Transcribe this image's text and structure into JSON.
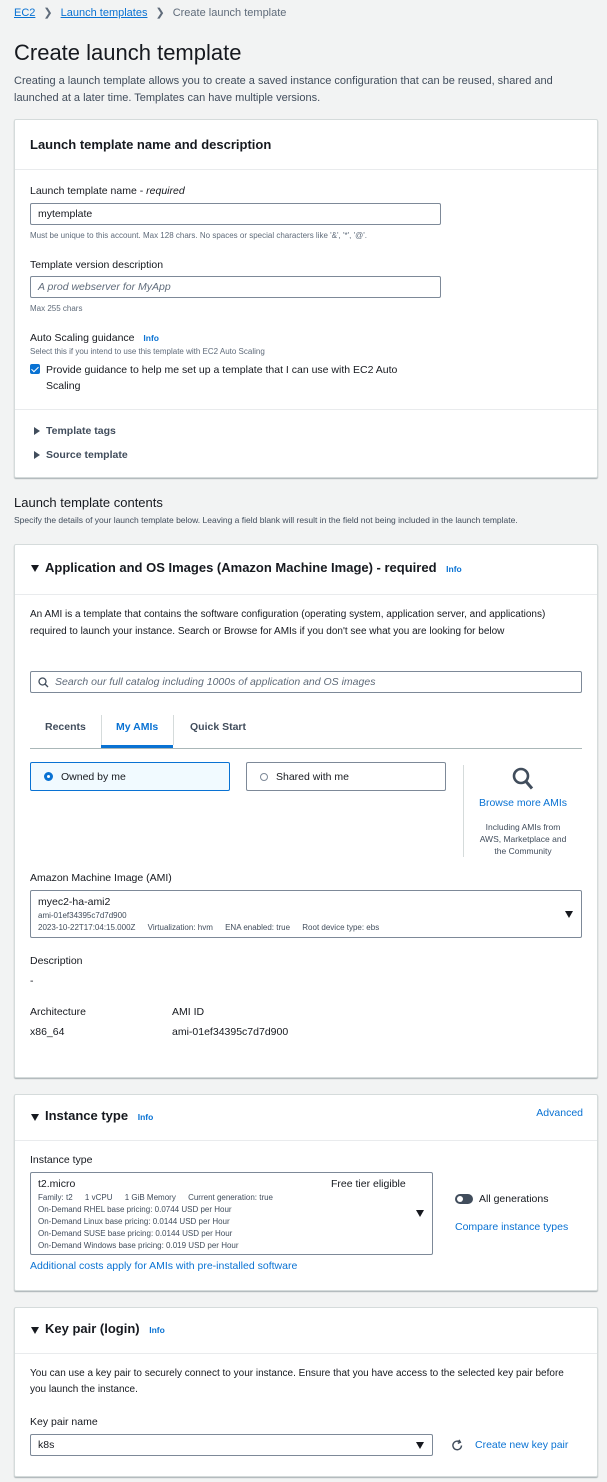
{
  "breadcrumb": {
    "root": "EC2",
    "parent": "Launch templates",
    "current": "Create launch template"
  },
  "page": {
    "title": "Create launch template",
    "subtitle": "Creating a launch template allows you to create a saved instance configuration that can be reused, shared and launched at a later time. Templates can have multiple versions."
  },
  "name_panel": {
    "title": "Launch template name and description",
    "name_label": "Launch template name - ",
    "name_required": "required",
    "name_value": "mytemplate",
    "name_hint": "Must be unique to this account. Max 128 chars. No spaces or special characters like '&', '*', '@'.",
    "desc_label": "Template version description",
    "desc_placeholder": "A prod webserver for MyApp",
    "desc_hint": "Max 255 chars",
    "asg_label": "Auto Scaling guidance",
    "asg_info": "Info",
    "asg_hint": "Select this if you intend to use this template with EC2 Auto Scaling",
    "asg_checkbox": "Provide guidance to help me set up a template that I can use with EC2 Auto Scaling",
    "asg_checked": true,
    "tags_label": "Template tags",
    "source_label": "Source template"
  },
  "contents": {
    "title": "Launch template contents",
    "subtitle": "Specify the details of your launch template below. Leaving a field blank will result in the field not being included in the launch template."
  },
  "ami_panel": {
    "title": "Application and OS Images (Amazon Machine Image) - required",
    "info": "Info",
    "description": "An AMI is a template that contains the software configuration (operating system, application server, and applications) required to launch your instance. Search or Browse for AMIs if you don't see what you are looking for below",
    "search_placeholder": "Search our full catalog including 1000s of application and OS images",
    "tabs": [
      "Recents",
      "My AMIs",
      "Quick Start"
    ],
    "active_tab": "My AMIs",
    "owned_label": "Owned by me",
    "shared_label": "Shared with me",
    "browse_label": "Browse more AMIs",
    "browse_hint": "Including AMIs from AWS, Marketplace and the Community",
    "ami_label": "Amazon Machine Image (AMI)",
    "ami_name": "myec2-ha-ami2",
    "ami_id_line": "ami-01ef34395c7d7d900",
    "ami_date": "2023-10-22T17:04:15.000Z",
    "ami_virt": "Virtualization: hvm",
    "ami_ena": "ENA enabled: true",
    "ami_root": "Root device type: ebs",
    "desc_label": "Description",
    "desc_value": "-",
    "arch_label": "Architecture",
    "arch_value": "x86_64",
    "amiid_label": "AMI ID",
    "amiid_value": "ami-01ef34395c7d7d900"
  },
  "instance_panel": {
    "title": "Instance type",
    "info": "Info",
    "advanced": "Advanced",
    "field_label": "Instance type",
    "type_name": "t2.micro",
    "free_tier": "Free tier eligible",
    "family": "Family: t2",
    "vcpu": "1 vCPU",
    "memory": "1 GiB Memory",
    "generation": "Current generation: true",
    "rhel": "On-Demand RHEL base pricing: 0.0744 USD per Hour",
    "linux": "On-Demand Linux base pricing: 0.0144 USD per Hour",
    "suse": "On-Demand SUSE base pricing: 0.0144 USD per Hour",
    "windows": "On-Demand Windows base pricing: 0.019 USD per Hour",
    "all_gen": "All generations",
    "compare": "Compare instance types",
    "costs_link": "Additional costs apply for AMIs with pre-installed software"
  },
  "keypair_panel": {
    "title": "Key pair (login)",
    "info": "Info",
    "description": "You can use a key pair to securely connect to your instance. Ensure that you have access to the selected key pair before you launch the instance.",
    "field_label": "Key pair name",
    "value": "k8s",
    "create_link": "Create new key pair"
  }
}
